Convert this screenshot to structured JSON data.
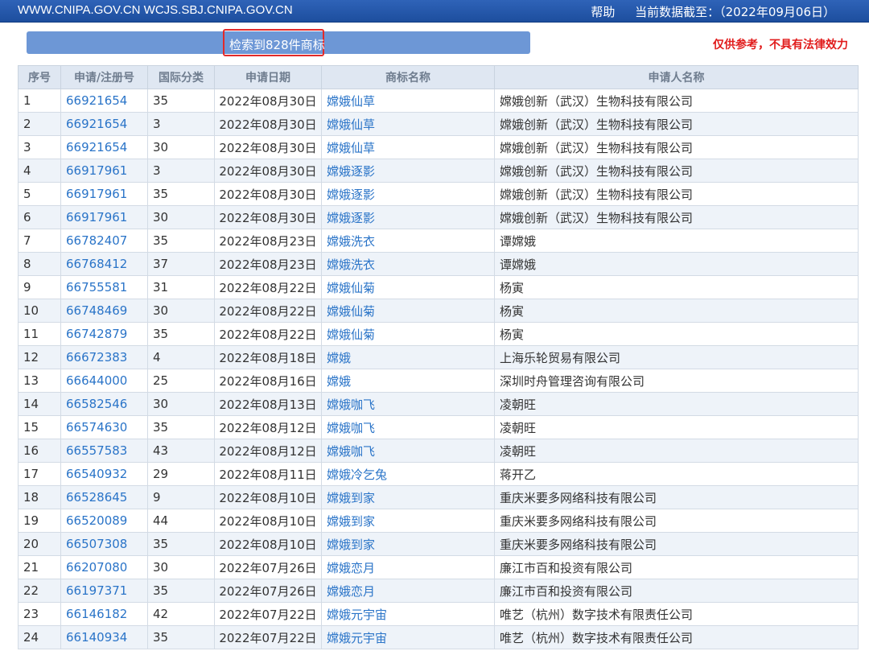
{
  "header": {
    "domains": "WWW.CNIPA.GOV.CN WCJS.SBJ.CNIPA.GOV.CN",
    "help": "帮助",
    "data_as_of": "当前数据截至：（2022年09月06日）"
  },
  "search": {
    "count_text": "检索到828件商标",
    "disclaimer": "仅供参考，不具有法律效力"
  },
  "table": {
    "columns": [
      "序号",
      "申请/注册号",
      "国际分类",
      "申请日期",
      "商标名称",
      "申请人名称"
    ],
    "rows": [
      [
        "1",
        "66921654",
        "35",
        "2022年08月30日",
        "嫦娥仙草",
        "嫦娥创新（武汉）生物科技有限公司"
      ],
      [
        "2",
        "66921654",
        "3",
        "2022年08月30日",
        "嫦娥仙草",
        "嫦娥创新（武汉）生物科技有限公司"
      ],
      [
        "3",
        "66921654",
        "30",
        "2022年08月30日",
        "嫦娥仙草",
        "嫦娥创新（武汉）生物科技有限公司"
      ],
      [
        "4",
        "66917961",
        "3",
        "2022年08月30日",
        "嫦娥逐影",
        "嫦娥创新（武汉）生物科技有限公司"
      ],
      [
        "5",
        "66917961",
        "35",
        "2022年08月30日",
        "嫦娥逐影",
        "嫦娥创新（武汉）生物科技有限公司"
      ],
      [
        "6",
        "66917961",
        "30",
        "2022年08月30日",
        "嫦娥逐影",
        "嫦娥创新（武汉）生物科技有限公司"
      ],
      [
        "7",
        "66782407",
        "35",
        "2022年08月23日",
        "嫦娥洗衣",
        "谭嫦娥"
      ],
      [
        "8",
        "66768412",
        "37",
        "2022年08月23日",
        "嫦娥洗衣",
        "谭嫦娥"
      ],
      [
        "9",
        "66755581",
        "31",
        "2022年08月22日",
        "嫦娥仙菊",
        "杨寅"
      ],
      [
        "10",
        "66748469",
        "30",
        "2022年08月22日",
        "嫦娥仙菊",
        "杨寅"
      ],
      [
        "11",
        "66742879",
        "35",
        "2022年08月22日",
        "嫦娥仙菊",
        "杨寅"
      ],
      [
        "12",
        "66672383",
        "4",
        "2022年08月18日",
        "嫦娥",
        "上海乐轮贸易有限公司"
      ],
      [
        "13",
        "66644000",
        "25",
        "2022年08月16日",
        "嫦娥",
        "深圳时舟管理咨询有限公司"
      ],
      [
        "14",
        "66582546",
        "30",
        "2022年08月13日",
        "嫦娥咖飞",
        "凌朝旺"
      ],
      [
        "15",
        "66574630",
        "35",
        "2022年08月12日",
        "嫦娥咖飞",
        "凌朝旺"
      ],
      [
        "16",
        "66557583",
        "43",
        "2022年08月12日",
        "嫦娥咖飞",
        "凌朝旺"
      ],
      [
        "17",
        "66540932",
        "29",
        "2022年08月11日",
        "嫦娥冷乞兔",
        "蒋开乙"
      ],
      [
        "18",
        "66528645",
        "9",
        "2022年08月10日",
        "嫦娥到家",
        "重庆米要多网络科技有限公司"
      ],
      [
        "19",
        "66520089",
        "44",
        "2022年08月10日",
        "嫦娥到家",
        "重庆米要多网络科技有限公司"
      ],
      [
        "20",
        "66507308",
        "35",
        "2022年08月10日",
        "嫦娥到家",
        "重庆米要多网络科技有限公司"
      ],
      [
        "21",
        "66207080",
        "30",
        "2022年07月26日",
        "嫦娥恋月",
        "廉江市百和投资有限公司"
      ],
      [
        "22",
        "66197371",
        "35",
        "2022年07月26日",
        "嫦娥恋月",
        "廉江市百和投资有限公司"
      ],
      [
        "23",
        "66146182",
        "42",
        "2022年07月22日",
        "嫦娥元宇宙",
        "唯艺（杭州）数字技术有限责任公司"
      ],
      [
        "24",
        "66140934",
        "35",
        "2022年07月22日",
        "嫦娥元宇宙",
        "唯艺（杭州）数字技术有限责任公司"
      ]
    ]
  }
}
